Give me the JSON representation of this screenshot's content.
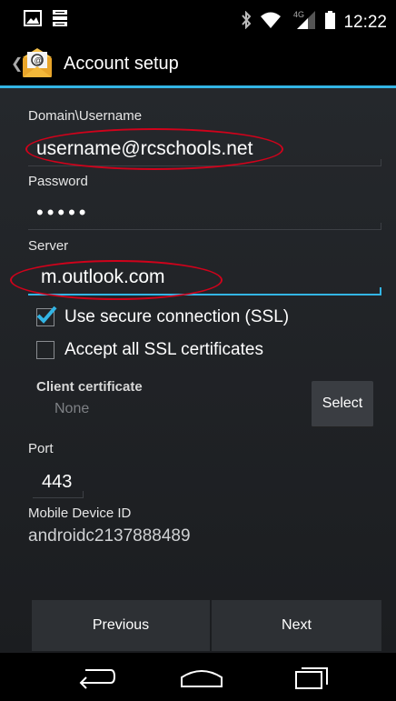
{
  "status_bar": {
    "time": "12:22",
    "network": "4G"
  },
  "action_bar": {
    "title": "Account setup"
  },
  "form": {
    "domain_username": {
      "label": "Domain\\Username",
      "value": "username@rcschools.net"
    },
    "password": {
      "label": "Password",
      "value": "•••••"
    },
    "server": {
      "label": "Server",
      "value": "m.outlook.com"
    },
    "ssl": {
      "label": "Use secure connection (SSL)",
      "checked": true
    },
    "accept_all": {
      "label": "Accept all SSL certificates",
      "checked": false
    },
    "client_certificate": {
      "label": "Client certificate",
      "value": "None",
      "select_label": "Select"
    },
    "port": {
      "label": "Port",
      "value": "443"
    },
    "device_id": {
      "label": "Mobile Device ID",
      "value": "androidc2137888489"
    }
  },
  "buttons": {
    "previous": "Previous",
    "next": "Next"
  },
  "colors": {
    "accent": "#33b5e5",
    "annotation": "#d0021b",
    "background": "#25282c"
  },
  "icons": [
    "image-icon",
    "notification-icon",
    "bluetooth-icon",
    "wifi-icon",
    "signal-icon",
    "battery-icon",
    "email-app-icon",
    "back-icon",
    "home-icon",
    "recents-icon"
  ]
}
